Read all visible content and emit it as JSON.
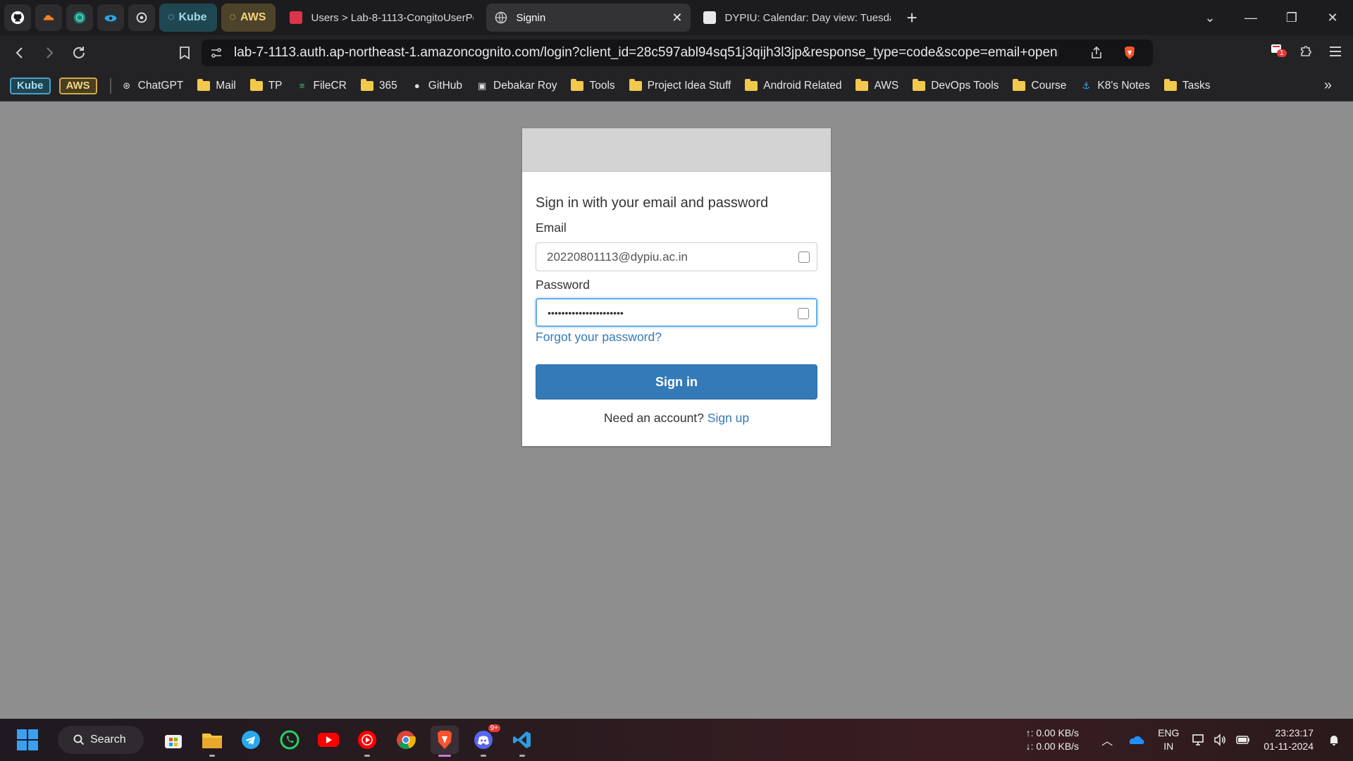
{
  "browser": {
    "group_tabs": [
      {
        "label": "Kube"
      },
      {
        "label": "AWS"
      }
    ],
    "tabs": [
      {
        "title": "Users > Lab-8-1113-CongitoUserPo",
        "active": false
      },
      {
        "title": "Signin",
        "active": true
      },
      {
        "title": "DYPIU: Calendar: Day view: Tuesday",
        "active": false
      }
    ],
    "url": "lab-7-1113.auth.ap-northeast-1.amazoncognito.com/login?client_id=28c597abl94sq51j3qijh3l3jp&response_type=code&scope=email+openid+phone&...",
    "bookmark_groups": [
      "Kube",
      "AWS"
    ],
    "bookmarks": [
      {
        "label": "ChatGPT",
        "icon": "chatgpt-icon"
      },
      {
        "label": "Mail",
        "icon": "folder-icon"
      },
      {
        "label": "TP",
        "icon": "folder-icon"
      },
      {
        "label": "FileCR",
        "icon": "filecr-icon"
      },
      {
        "label": "365",
        "icon": "folder-icon"
      },
      {
        "label": "GitHub",
        "icon": "github-icon"
      },
      {
        "label": "Debakar Roy",
        "icon": "avatar-icon"
      },
      {
        "label": "Tools",
        "icon": "folder-icon"
      },
      {
        "label": "Project Idea Stuff",
        "icon": "folder-icon"
      },
      {
        "label": "Android Related",
        "icon": "folder-icon"
      },
      {
        "label": "AWS",
        "icon": "folder-icon"
      },
      {
        "label": "DevOps Tools",
        "icon": "folder-icon"
      },
      {
        "label": "Course",
        "icon": "folder-icon"
      },
      {
        "label": "K8's Notes",
        "icon": "anchor-icon"
      },
      {
        "label": "Tasks",
        "icon": "folder-icon"
      }
    ],
    "extension_badge": "1"
  },
  "login": {
    "title": "Sign in with your email and password",
    "email_label": "Email",
    "email_value": "20220801113@dypiu.ac.in",
    "password_label": "Password",
    "password_value": "••••••••••••••••••••••",
    "forgot_link": "Forgot your password?",
    "signin_button": "Sign in",
    "need_account": "Need an account?",
    "signup_link": "Sign up"
  },
  "taskbar": {
    "search_label": "Search",
    "discord_badge": "9+",
    "net_up": "↑: 0.00 KB/s",
    "net_down": "↓: 0.00 KB/s",
    "lang_top": "ENG",
    "lang_bottom": "IN",
    "time": "23:23:17",
    "date": "01-11-2024"
  },
  "colors": {
    "page_bg": "#8e8e8e",
    "primary": "#337ab7",
    "banner": "#d3d3d3"
  }
}
